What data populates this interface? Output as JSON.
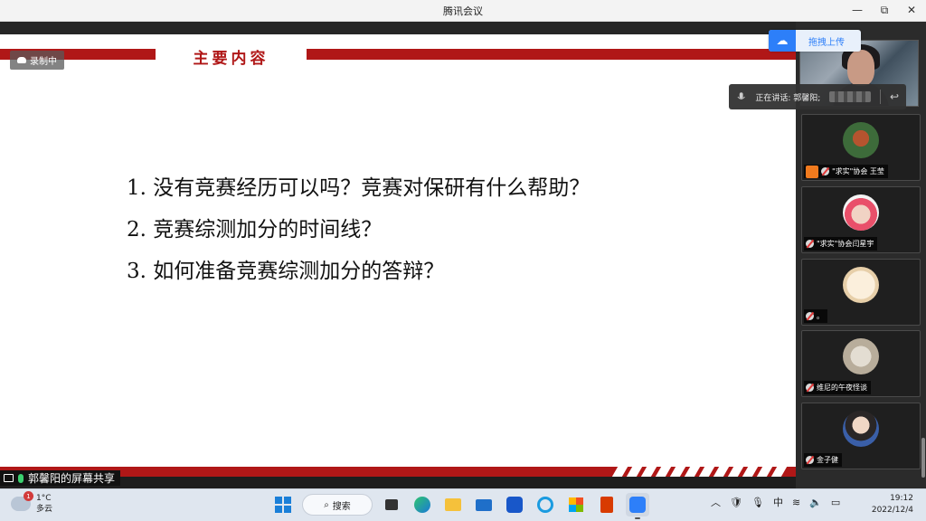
{
  "window": {
    "title": "腾讯会议",
    "minimize": "—",
    "restore": "⧉",
    "close": "✕"
  },
  "recording": {
    "label": "录制中"
  },
  "slide": {
    "heading": "主要内容",
    "items": [
      "1.  没有竞赛经历可以吗？竞赛对保研有什么帮助？",
      "2.  竞赛综测加分的时间线？",
      "3.  如何准备竞赛综测加分的答辩？"
    ]
  },
  "share_label": "郭馨阳的屏幕共享",
  "upload": {
    "label": "拖拽上传"
  },
  "speaking": {
    "label": "正在讲话: 郭馨阳;"
  },
  "participants": [
    {
      "name": "\"求实\"协会 王莹",
      "host": true
    },
    {
      "name": "\"求实\"协会闫星宇",
      "host": false
    },
    {
      "name": "。",
      "host": false
    },
    {
      "name": "维尼的午夜怪谈",
      "host": false
    },
    {
      "name": "金子健",
      "host": false
    }
  ],
  "taskbar": {
    "weather_temp": "1°C",
    "weather_desc": "多云",
    "weather_badge": "1",
    "search_label": "搜索",
    "ime": "中",
    "time": "19:12",
    "date": "2022/12/4"
  }
}
